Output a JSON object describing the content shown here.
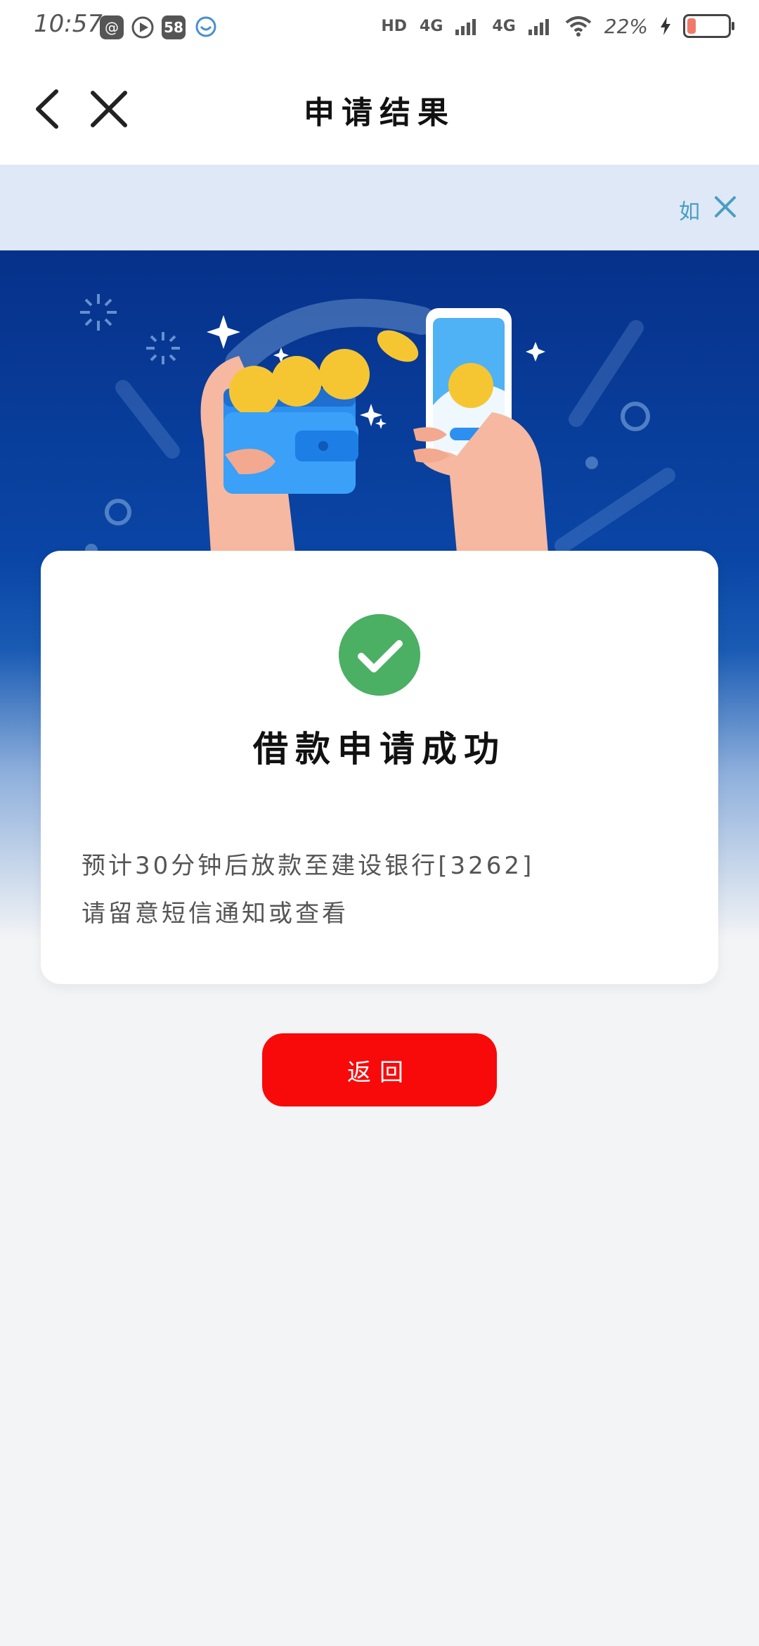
{
  "status_bar": {
    "time": "10:57",
    "icons": [
      "at-icon",
      "play-icon",
      "58-icon",
      "chat-icon"
    ],
    "app_badge": "58",
    "network": [
      "HD",
      "4G",
      "4G"
    ],
    "battery_percent": "22%",
    "battery_level": 0.22
  },
  "nav": {
    "title": "申请结果",
    "back_icon": "chevron-left-icon",
    "close_icon": "close-icon"
  },
  "notice": {
    "text": "如",
    "close_icon": "close-icon"
  },
  "hero": {
    "illustration": "wallet-phone-coins-illustration"
  },
  "card": {
    "status_icon": "check-circle-icon",
    "title": "借款申请成功",
    "line1": "预计30分钟后放款至建设银行[3262]",
    "line2": "请留意短信通知或查看"
  },
  "actions": {
    "return_label": "返回"
  },
  "colors": {
    "accent_red": "#f80a0a",
    "success_green": "#4bb064",
    "hero_blue": "#0a46a6",
    "notice_bg": "#dfe8f6"
  }
}
